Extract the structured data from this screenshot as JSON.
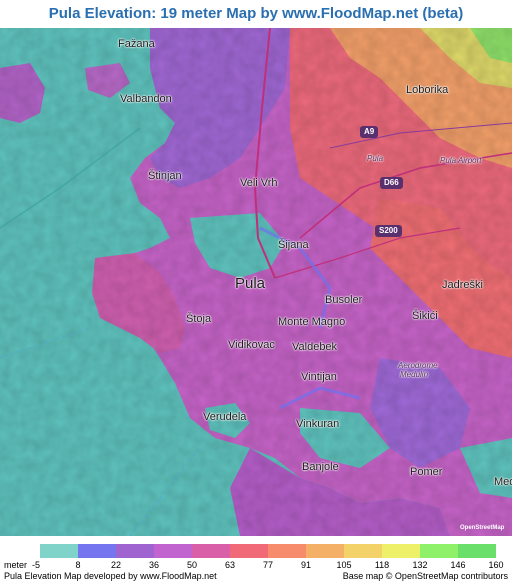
{
  "title": "Pula Elevation: 19 meter Map by www.FloodMap.net (beta)",
  "places": {
    "fazana": "Fažana",
    "valbandon": "Valbandon",
    "loborika": "Loborika",
    "stinjan": "Štinjan",
    "veli_vrh": "Veli Vrh",
    "pula_small": "Pula",
    "pula_airport": "Pula Airport",
    "sijana": "Šijana",
    "pula": "Pula",
    "jadreski": "Jadreški",
    "busoler": "Busoler",
    "stoja": "Štoja",
    "monte_magno": "Monte Magno",
    "sikici": "Šikići",
    "vidikovac": "Vidikovac",
    "valdebek": "Valdebek",
    "aerodrome": "Aerodrome",
    "medulin_air": "Medulin",
    "vintijan": "Vintijan",
    "verudela": "Verudela",
    "vinkuran": "Vinkuran",
    "banjole": "Banjole",
    "pomer": "Pomer",
    "med": "Med"
  },
  "roads": {
    "a9": "A9",
    "d66": "D66",
    "s200": "S200"
  },
  "legend": {
    "unit": "meter",
    "ticks": [
      "-5",
      "8",
      "22",
      "36",
      "50",
      "63",
      "77",
      "91",
      "105",
      "118",
      "132",
      "146",
      "160"
    ],
    "colors": [
      "#7fd3c8",
      "#7575f0",
      "#a064d0",
      "#c264d0",
      "#d85fa8",
      "#f06a78",
      "#f68c6c",
      "#f5b068",
      "#f3d26a",
      "#eef06a",
      "#8ff06a",
      "#6adf6a"
    ]
  },
  "footer": {
    "left": "Pula Elevation Map developed by www.FloodMap.net",
    "right": "Base map © OpenStreetMap contributors"
  },
  "logo_text": "OpenStreetMap"
}
